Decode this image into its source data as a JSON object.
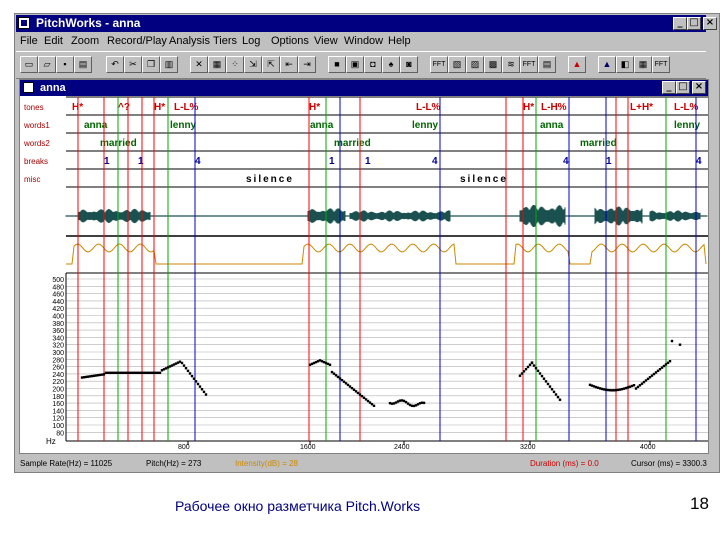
{
  "app": {
    "title": "PitchWorks - anna",
    "child_title": "anna"
  },
  "window_buttons": {
    "minimize": "_",
    "maximize": "□",
    "close": "×"
  },
  "menu": [
    "File",
    "Edit",
    "Zoom",
    "Record/Play",
    "Analysis",
    "Tiers",
    "Log",
    "Options",
    "View",
    "Window",
    "Help"
  ],
  "toolbar": {
    "text_buttons": [
      "FFT",
      "FFT",
      "FFT"
    ]
  },
  "tiers": {
    "labels": [
      "tones",
      "words1",
      "words2",
      "breaks",
      "misc"
    ],
    "tones": [
      "H*",
      "^?",
      "H*",
      "L-L%",
      "H*",
      "L-L%",
      "H*",
      "L-H%",
      "L+H*",
      "L-L%"
    ],
    "words1": [
      "anna",
      "lenny",
      "anna",
      "lenny",
      "anna",
      "lenny"
    ],
    "words2": [
      "married",
      "married",
      "married"
    ],
    "breaks": [
      "1",
      "1",
      "4",
      "1",
      "1",
      "4",
      "4",
      "1",
      "4"
    ],
    "misc": [
      "silence",
      "silence"
    ]
  },
  "pitch_axis": {
    "ticks": [
      "500",
      "480",
      "460",
      "440",
      "420",
      "400",
      "380",
      "360",
      "340",
      "320",
      "300",
      "280",
      "260",
      "240",
      "220",
      "200",
      "180",
      "160",
      "140",
      "120",
      "100",
      "80"
    ],
    "unit": "Hz"
  },
  "time_axis": {
    "ticks": [
      "800",
      "1600",
      "2400",
      "3200",
      "4000"
    ]
  },
  "status": {
    "sample_rate": "Sample Rate(Hz) = 11025",
    "pitch": "Pitch(Hz) = 273",
    "intensity": "Intensity(dB) = 28",
    "duration": "Duration (ms) = 0.0",
    "cursor": "Cursor (ms) = 3300.3"
  },
  "colors": {
    "titlebar": "#000080",
    "chrome": "#c0c0c0",
    "tone_label": "#cc0000",
    "word_label": "#006600",
    "break_label": "#000099",
    "marker_red": "#ff0000",
    "marker_green": "#00aa00",
    "marker_blue": "#0000cc",
    "waveform": "#1a5050",
    "intensity": "#cc8800"
  },
  "caption": "Рабочее окно разметчика Pitch.Works",
  "page_number": "18"
}
